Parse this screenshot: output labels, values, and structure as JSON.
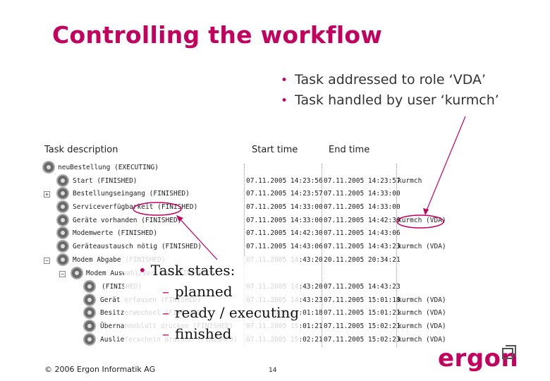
{
  "title": "Controlling the workflow",
  "bullets": [
    "Task addressed to role ‘VDA’",
    "Task handled by user ‘kurmch’"
  ],
  "columns": {
    "task": "Task description",
    "start": "Start time",
    "end": "End time"
  },
  "rows": [
    {
      "task": "neuBestellung (EXECUTING)",
      "start": "",
      "end": "",
      "user": ""
    },
    {
      "task": "Start (FINISHED)",
      "start": "07.11.2005 14:23:56",
      "end": "07.11.2005 14:23:57",
      "user": "kurmch"
    },
    {
      "task": "Bestellungseingang (FINISHED)",
      "start": "07.11.2005 14:23:57",
      "end": "07.11.2005 14:33:00",
      "user": ""
    },
    {
      "task": "Serviceverfügbarkeit (FINISHED)",
      "start": "07.11.2005 14:33:00",
      "end": "07.11.2005 14:33:00",
      "user": ""
    },
    {
      "task": "Geräte vorhanden (FINISHED)",
      "start": "07.11.2005 14:33:00",
      "end": "07.11.2005 14:42:30",
      "user": "kurmch (VDA)"
    },
    {
      "task": "Modemwerte (FINISHED)",
      "start": "07.11.2005 14:42:30",
      "end": "07.11.2005 14:43:06",
      "user": ""
    },
    {
      "task": "Geräteaustausch nötig (FINISHED)",
      "start": "07.11.2005 14:43:06",
      "end": "07.11.2005 14:43:23",
      "user": "kurmch (VDA)"
    },
    {
      "task": "Modem Abgabe (FINISHED)",
      "start": "07.11.2005 14:43:20",
      "end": "20.11.2005 20:34:21",
      "user": ""
    },
    {
      "task": "Modem Auswahl/Versand (FINISHED)",
      "start": "",
      "end": "",
      "user": ""
    },
    {
      "task": "(FINISHED)",
      "start": "07.11.2005 14:43:20",
      "end": "07.11.2005 14:43:23",
      "user": ""
    },
    {
      "task": "Gerät erfassen (FINISHED)",
      "start": "07.11.2005 14:43:23",
      "end": "07.11.2005 15:01:18",
      "user": "kurmch (VDA)"
    },
    {
      "task": "Besitzerwechsel (FINISHED)",
      "start": "07.11.2005 15:01:18",
      "end": "07.11.2005 15:01:21",
      "user": "kurmch (VDA)"
    },
    {
      "task": "Übernahmeblatt drucken (FINISHED)",
      "start": "07.11.2005 15:01:21",
      "end": "07.11.2005 15:02:21",
      "user": "kurmch (VDA)"
    },
    {
      "task": "Auslieferschein drucken (FINISHED)",
      "start": "07.11.2005 15:02:21",
      "end": "07.11.2005 15:02:23",
      "user": "kurmch (VDA)"
    }
  ],
  "states": {
    "heading": "Task states:",
    "items": [
      "planned",
      "ready / executing",
      "finished"
    ]
  },
  "footer": {
    "copyright": "© 2006 Ergon Informatik AG",
    "page": "14"
  },
  "logo": "ergon",
  "colors": {
    "accent": "#c4005f"
  }
}
